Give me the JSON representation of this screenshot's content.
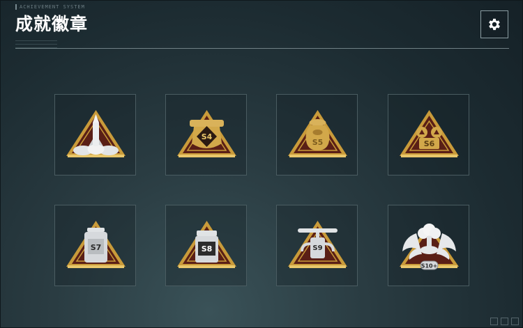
{
  "header": {
    "title": "成就徽章",
    "subtitle_small": "ACHIEVEMENT SYSTEM"
  },
  "settings": {
    "icon": "gear-icon"
  },
  "badges": [
    {
      "label": "",
      "emblem": "rocket-launch",
      "metal": "gold"
    },
    {
      "label": "S4",
      "emblem": "barrel-cannon",
      "metal": "gold"
    },
    {
      "label": "S5",
      "emblem": "sack-bag",
      "metal": "gold"
    },
    {
      "label": "S6",
      "emblem": "twin-shields",
      "metal": "gold"
    },
    {
      "label": "S7",
      "emblem": "fuel-canister",
      "metal": "silver"
    },
    {
      "label": "S8",
      "emblem": "generator-box",
      "metal": "silver"
    },
    {
      "label": "S9",
      "emblem": "rotor-drone",
      "metal": "silver"
    },
    {
      "label": "S10+",
      "emblem": "winged-mushroom-cloud",
      "metal": "silver"
    }
  ],
  "colors": {
    "gold": "#d2a84a",
    "silver": "#d6d9dc",
    "triangle_fill": "#5a1f16",
    "accent_border": "#c99b3a"
  }
}
